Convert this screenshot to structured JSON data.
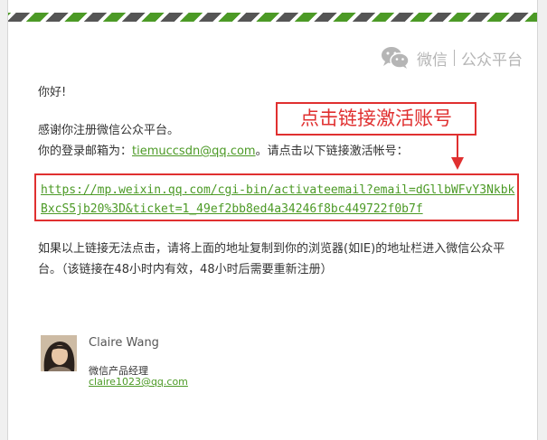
{
  "brand": {
    "name": "微信",
    "product": "公众平台",
    "logo_icon": "wechat-logo-icon"
  },
  "email": {
    "greeting": "你好!",
    "thanks": "感谢你注册微信公众平台。",
    "login_prefix": "你的登录邮箱为：",
    "login_email": "tiemuccsdn@qq.com",
    "login_suffix": "。请点击以下链接激活帐号：",
    "activation_link": "https://mp.weixin.qq.com/cgi-bin/activateemail?email=dGllbWFvY3NkbkBxcS5jb20%3D&ticket=1_49ef2bb8ed4a34246f8bc449722f0b7f",
    "instructions": "如果以上链接无法点击，请将上面的地址复制到你的浏览器(如IE)的地址栏进入微信公众平台。（该链接在48小时内有效，48小时后需要重新注册）"
  },
  "annotation": {
    "label": "点击链接激活账号",
    "color": "#e03030",
    "arrow_icon": "arrow-down-icon"
  },
  "signature": {
    "name": "Claire Wang",
    "title": "微信产品经理",
    "email": "claire1023@qq.com",
    "avatar_icon": "avatar-photo"
  },
  "colors": {
    "link": "#4c9a26",
    "stripe_green": "#4c9a26",
    "stripe_dark": "#555555",
    "brand_gray": "#b5b5b5"
  }
}
